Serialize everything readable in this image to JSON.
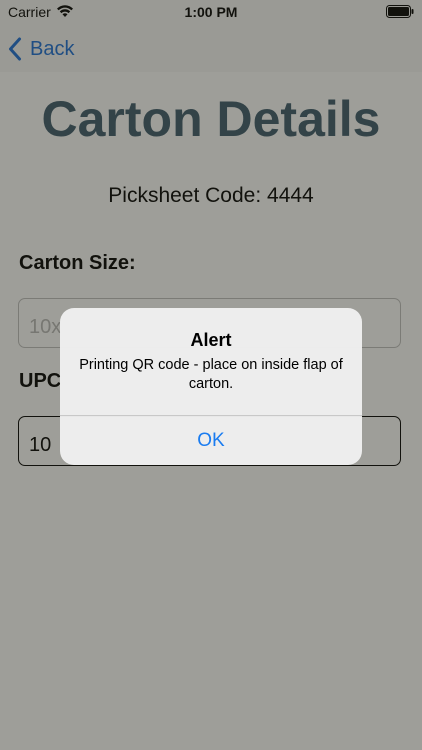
{
  "status_bar": {
    "carrier": "Carrier",
    "time": "1:00 PM"
  },
  "nav": {
    "back_label": "Back"
  },
  "page": {
    "title": "Carton Details",
    "picksheet": "Picksheet Code: 4444",
    "carton_size_label": "Carton Size:",
    "carton_size_value": "10x",
    "upc_label": "UPC",
    "upc_value": "10"
  },
  "alert": {
    "title": "Alert",
    "message": "Printing QR code - place on inside flap of carton.",
    "ok_label": "OK"
  },
  "colors": {
    "accent": "#1a7cf0",
    "title": "#3d5a6c"
  },
  "icons": {
    "wifi": "wifi-icon",
    "battery": "battery-icon",
    "back": "chevron-left-icon"
  }
}
